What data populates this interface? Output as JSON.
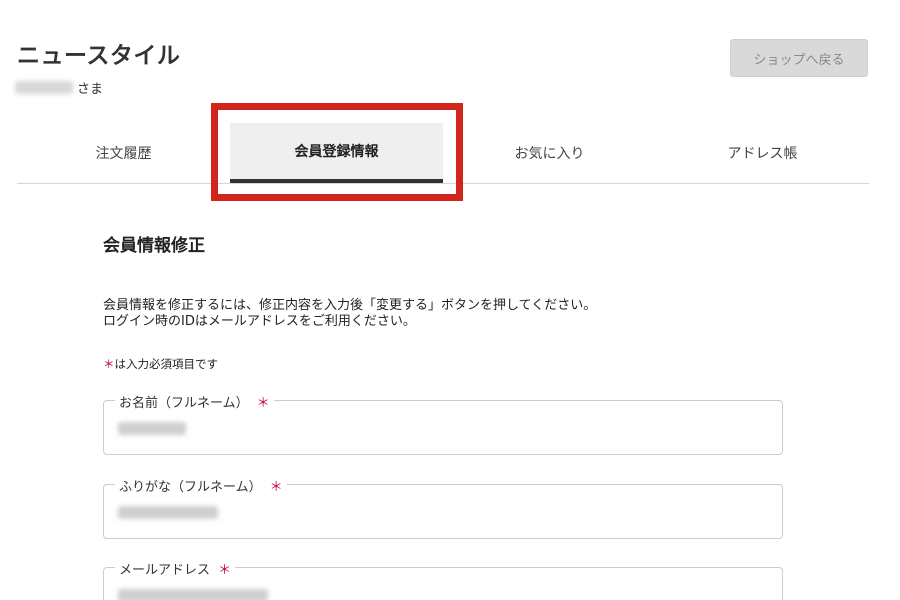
{
  "header": {
    "shop_title": "ニュースタイル",
    "user_suffix": "さま",
    "back_button": "ショップへ戻る"
  },
  "tabs": [
    {
      "label": "注文履歴",
      "active": false
    },
    {
      "label": "会員登録情報",
      "active": true
    },
    {
      "label": "お気に入り",
      "active": false
    },
    {
      "label": "アドレス帳",
      "active": false
    }
  ],
  "main": {
    "section_title": "会員情報修正",
    "intro_line1": "会員情報を修正するには、修正内容を入力後「変更する」ボタンを押してください。",
    "intro_line2": "ログイン時のIDはメールアドレスをご利用ください。",
    "required_mark": "＊",
    "required_note": "は入力必須項目です"
  },
  "form": {
    "fields": [
      {
        "label": "お名前（フルネーム）"
      },
      {
        "label": "ふりがな（フルネーム）"
      },
      {
        "label": "メールアドレス"
      }
    ]
  },
  "colors": {
    "highlight": "#d0261b",
    "required": "#c8004a"
  }
}
